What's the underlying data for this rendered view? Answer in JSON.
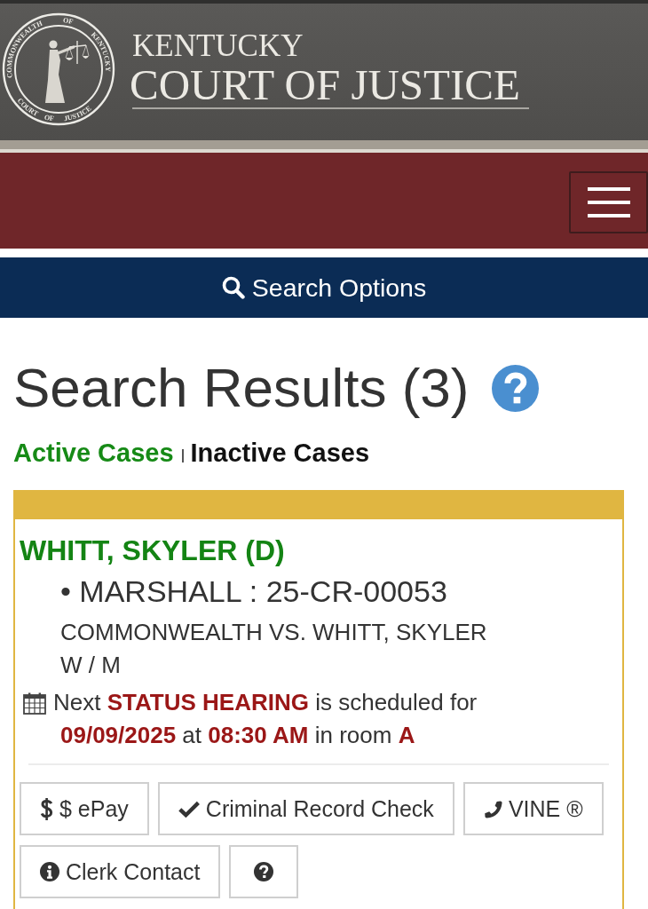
{
  "header": {
    "seal": {
      "top_text": "COMMONWEALTH OF KENTUCKY",
      "bottom_text": "COURT OF JUSTICE"
    },
    "title_small": "KENTUCKY",
    "title_large": "COURT OF JUSTICE"
  },
  "search_options": {
    "label": "Search Options"
  },
  "results": {
    "title": "Search Results (3)"
  },
  "case_filters": [
    {
      "label": "Active Cases",
      "selected": true
    },
    {
      "label": "Inactive Cases",
      "selected": false
    }
  ],
  "cases": [
    {
      "party": "WHITT, SKYLER (D)",
      "case_number_line": "• MARSHALL : 25-CR-00053",
      "case_style": "COMMONWEALTH VS. WHITT, SKYLER",
      "race_sex": "W / M",
      "next_event": "Next **STATUS HEARING** is scheduled for\n**09/09/2025** at **08:30 AM** in room **A**",
      "actions": [
        {
          "kind": "pay",
          "label": "$ ePay"
        },
        {
          "kind": "record_check",
          "label": "Criminal Record Check"
        },
        {
          "kind": "vine",
          "label": "VINE ®"
        },
        {
          "kind": "contact",
          "label": "Clerk Contact"
        },
        {
          "kind": "help"
        }
      ]
    }
  ]
}
